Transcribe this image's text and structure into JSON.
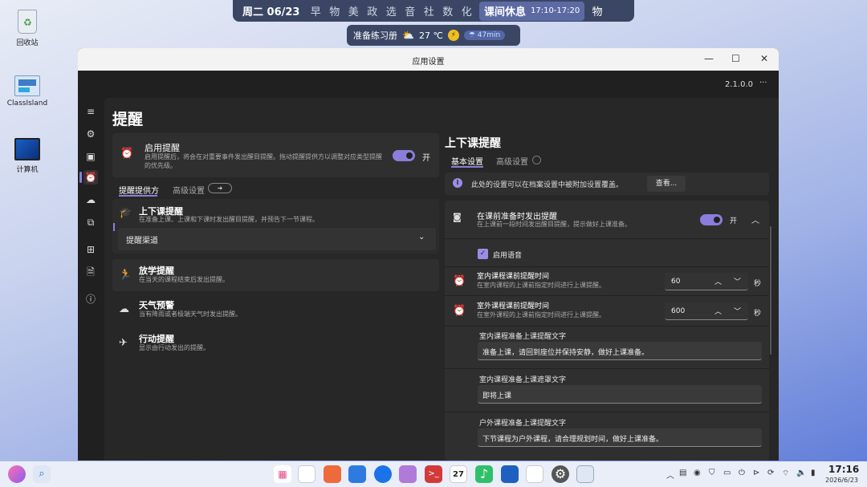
{
  "desktop": {
    "icons": [
      {
        "label": "回收站"
      },
      {
        "label": "ClassIsland"
      },
      {
        "label": "计算机"
      }
    ]
  },
  "topbar": {
    "date": "周二 06/23",
    "subjects": [
      "早",
      "物",
      "美",
      "政",
      "选",
      "音",
      "社",
      "数",
      "化"
    ],
    "break_label": "课间休息",
    "break_time": "17:10-17:20",
    "next_subject": "物"
  },
  "subbar": {
    "text": "准备练习册",
    "weather_icon": "partly-cloudy-icon",
    "temp": "27 ℃",
    "duration": "47min"
  },
  "window": {
    "title": "应用设置",
    "version": "2.1.0.0",
    "more": "···",
    "controls": {
      "minimize": "—",
      "maximize": "☐",
      "close": "✕"
    }
  },
  "page": {
    "title": "提醒",
    "enable": {
      "title": "启用提醒",
      "desc": "启用提醒后，将会在对重要事件发出醒目提醒。拖动提醒提供方以调整对应类型提醒的优先级。",
      "state": "开"
    },
    "left_tabs": [
      "提醒提供方",
      "高级设置"
    ],
    "left_tab_badge": "➜",
    "providers": [
      {
        "title": "上下课提醒",
        "desc": "在准备上课、上课和下课时发出醒目提醒，并预告下一节课程。",
        "icon": "graduation-cap-icon"
      },
      {
        "title": "放学提醒",
        "desc": "在当天的课程结束后发出提醒。",
        "icon": "running-person-icon"
      },
      {
        "title": "天气预警",
        "desc": "当有降雨或者极端天气时发出提醒。",
        "icon": "cloud-icon"
      },
      {
        "title": "行动提醒",
        "desc": "显示由行动发出的提醒。",
        "icon": "plane-icon"
      }
    ],
    "channel_label": "提醒渠道"
  },
  "right": {
    "title": "上下课提醒",
    "tabs": [
      "基本设置",
      "高级设置"
    ],
    "info_text": "此处的设置可以在档案设置中被附加设置覆盖。",
    "view_button": "查看...",
    "before_class": {
      "title": "在课前准备时发出提醒",
      "desc": "在上课前一段时间发出醒目提醒，提示做好上课准备。",
      "state": "开"
    },
    "voice_label": "启用语音",
    "indoor_time": {
      "title": "室内课程课前提醒时间",
      "desc": "在室内课程的上课前指定时间进行上课提醒。",
      "value": "60",
      "unit": "秒"
    },
    "outdoor_time": {
      "title": "室外课程课前提醒时间",
      "desc": "在室外课程的上课前指定时间进行上课提醒。",
      "value": "600",
      "unit": "秒"
    },
    "texts": [
      {
        "label": "室内课程准备上课提醒文字",
        "value": "准备上课，请回到座位并保持安静，做好上课准备。"
      },
      {
        "label": "室内课程准备上课遮罩文字",
        "value": "即将上课"
      },
      {
        "label": "户外课程准备上课提醒文字",
        "value": "下节课程为户外课程，请合理规划时间，做好上课准备。"
      }
    ]
  },
  "taskbar": {
    "time": "17:16",
    "date": "2026/6/23",
    "calendar_day": "27"
  },
  "colors": {
    "accent": "#8a7ddc",
    "window_bg": "#202020",
    "card": "#2f2f2f"
  }
}
